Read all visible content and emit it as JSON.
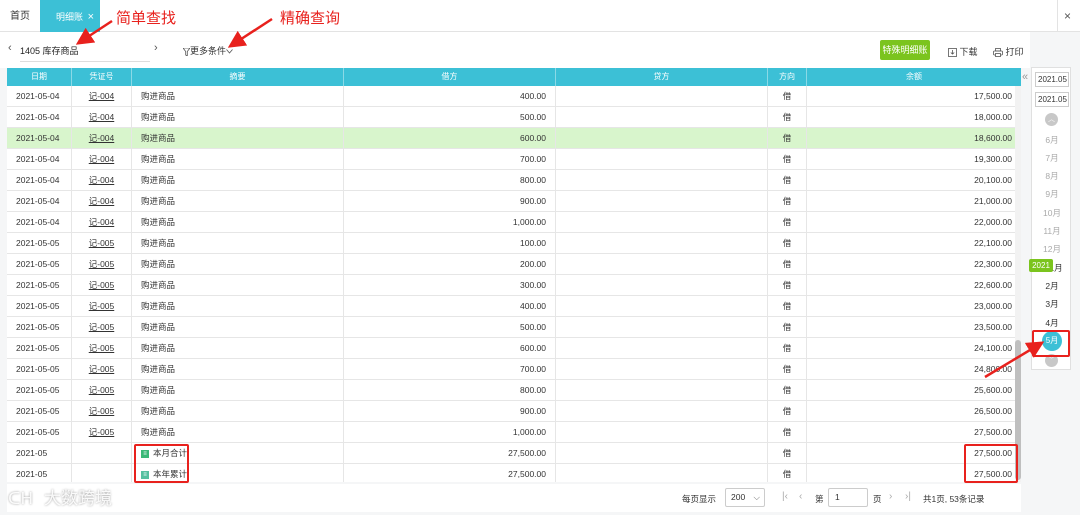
{
  "tabs": {
    "home": "首页",
    "active": "明细账",
    "close": "×",
    "right_close": "×"
  },
  "toolbar": {
    "prev": "‹",
    "next": "›",
    "account": "1405 库存商品",
    "more_conditions": "更多条件",
    "special_detail": "特殊明细账",
    "download": "下载",
    "print": "打印"
  },
  "table": {
    "columns": [
      "日期",
      "凭证号",
      "摘要",
      "借方",
      "贷方",
      "方向",
      "余额"
    ],
    "rows": [
      {
        "date": "2021-05-04",
        "voucher": "记-004",
        "summary": "购进商品",
        "debit": "400.00",
        "credit": "",
        "dir": "借",
        "balance": "17,500.00"
      },
      {
        "date": "2021-05-04",
        "voucher": "记-004",
        "summary": "购进商品",
        "debit": "500.00",
        "credit": "",
        "dir": "借",
        "balance": "18,000.00"
      },
      {
        "date": "2021-05-04",
        "voucher": "记-004",
        "summary": "购进商品",
        "debit": "600.00",
        "credit": "",
        "dir": "借",
        "balance": "18,600.00",
        "highlight": true
      },
      {
        "date": "2021-05-04",
        "voucher": "记-004",
        "summary": "购进商品",
        "debit": "700.00",
        "credit": "",
        "dir": "借",
        "balance": "19,300.00"
      },
      {
        "date": "2021-05-04",
        "voucher": "记-004",
        "summary": "购进商品",
        "debit": "800.00",
        "credit": "",
        "dir": "借",
        "balance": "20,100.00"
      },
      {
        "date": "2021-05-04",
        "voucher": "记-004",
        "summary": "购进商品",
        "debit": "900.00",
        "credit": "",
        "dir": "借",
        "balance": "21,000.00"
      },
      {
        "date": "2021-05-04",
        "voucher": "记-004",
        "summary": "购进商品",
        "debit": "1,000.00",
        "credit": "",
        "dir": "借",
        "balance": "22,000.00"
      },
      {
        "date": "2021-05-05",
        "voucher": "记-005",
        "summary": "购进商品",
        "debit": "100.00",
        "credit": "",
        "dir": "借",
        "balance": "22,100.00"
      },
      {
        "date": "2021-05-05",
        "voucher": "记-005",
        "summary": "购进商品",
        "debit": "200.00",
        "credit": "",
        "dir": "借",
        "balance": "22,300.00"
      },
      {
        "date": "2021-05-05",
        "voucher": "记-005",
        "summary": "购进商品",
        "debit": "300.00",
        "credit": "",
        "dir": "借",
        "balance": "22,600.00"
      },
      {
        "date": "2021-05-05",
        "voucher": "记-005",
        "summary": "购进商品",
        "debit": "400.00",
        "credit": "",
        "dir": "借",
        "balance": "23,000.00"
      },
      {
        "date": "2021-05-05",
        "voucher": "记-005",
        "summary": "购进商品",
        "debit": "500.00",
        "credit": "",
        "dir": "借",
        "balance": "23,500.00"
      },
      {
        "date": "2021-05-05",
        "voucher": "记-005",
        "summary": "购进商品",
        "debit": "600.00",
        "credit": "",
        "dir": "借",
        "balance": "24,100.00"
      },
      {
        "date": "2021-05-05",
        "voucher": "记-005",
        "summary": "购进商品",
        "debit": "700.00",
        "credit": "",
        "dir": "借",
        "balance": "24,800.00"
      },
      {
        "date": "2021-05-05",
        "voucher": "记-005",
        "summary": "购进商品",
        "debit": "800.00",
        "credit": "",
        "dir": "借",
        "balance": "25,600.00"
      },
      {
        "date": "2021-05-05",
        "voucher": "记-005",
        "summary": "购进商品",
        "debit": "900.00",
        "credit": "",
        "dir": "借",
        "balance": "26,500.00"
      },
      {
        "date": "2021-05-05",
        "voucher": "记-005",
        "summary": "购进商品",
        "debit": "1,000.00",
        "credit": "",
        "dir": "借",
        "balance": "27,500.00"
      },
      {
        "date": "2021-05",
        "voucher": "",
        "summary": "本月合计",
        "debit": "27,500.00",
        "credit": "",
        "dir": "借",
        "balance": "27,500.00",
        "sum": true
      },
      {
        "date": "2021-05",
        "voucher": "",
        "summary": "本年累计",
        "debit": "27,500.00",
        "credit": "",
        "dir": "借",
        "balance": "27,500.00",
        "sum": true
      }
    ]
  },
  "pagination": {
    "per_page_label": "每页显示",
    "per_page": "200",
    "di": "第",
    "page": "1",
    "ye": "页",
    "total": "共1页, 53条记录"
  },
  "date_panel": {
    "collapse": "«",
    "start": "2021.05",
    "end": "2021.05",
    "prev_year_months": [
      "6月",
      "7月",
      "8月",
      "9月",
      "10月",
      "11月",
      "12月"
    ],
    "year_badge": "2021",
    "months": [
      "1月",
      "2月",
      "3月",
      "4月"
    ],
    "selected_month": "5月"
  },
  "annotations": {
    "simple_search": "简单查找",
    "precise_query": "精确查询"
  },
  "watermark": "大数跨境",
  "colors": {
    "accent": "#3cc0d6",
    "green": "#7bc41e",
    "highlight_row": "#d8f5cc",
    "annotation": "#e8211d"
  }
}
